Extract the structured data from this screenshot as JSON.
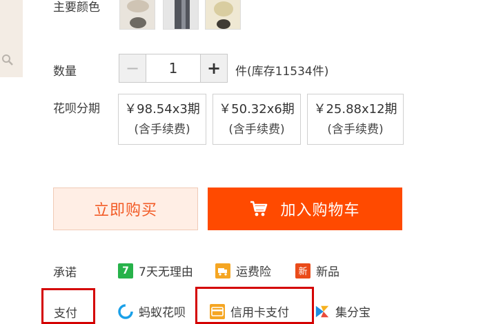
{
  "main_color": {
    "label": "主要颜色"
  },
  "quantity": {
    "label": "数量",
    "minus": "−",
    "value": "1",
    "plus": "+",
    "stock_text": "件(库存11534件)"
  },
  "installment": {
    "label": "花呗分期",
    "options": [
      {
        "price": "￥98.54x3期",
        "fee": "(含手续费)"
      },
      {
        "price": "￥50.32x6期",
        "fee": "(含手续费)"
      },
      {
        "price": "￥25.88x12期",
        "fee": "(含手续费)"
      }
    ]
  },
  "actions": {
    "buy_now": "立即购买",
    "add_to_cart": "加入购物车"
  },
  "promise": {
    "label": "承诺",
    "items": [
      {
        "icon_text": "7",
        "text": "7天无理由"
      },
      {
        "icon_text": "",
        "text": "运费险"
      },
      {
        "icon_text": "新",
        "text": "新品"
      }
    ]
  },
  "payment": {
    "label": "支付",
    "items": [
      {
        "text": "蚂蚁花呗"
      },
      {
        "text": "信用卡支付"
      },
      {
        "text": "集分宝"
      }
    ]
  },
  "colors": {
    "accent": "#ff4a00",
    "buy_bg": "#ffeee5",
    "highlight": "#d40000"
  }
}
